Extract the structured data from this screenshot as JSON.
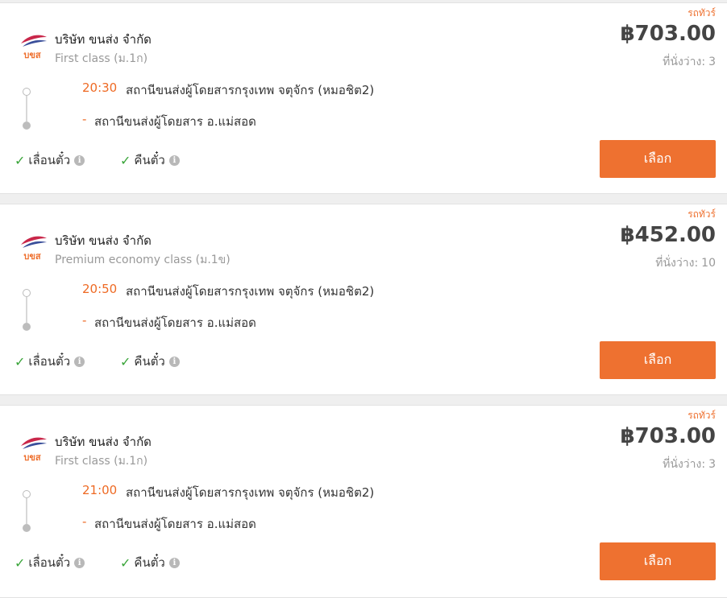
{
  "results": [
    {
      "tag": "รถทัวร์",
      "company": "บริษัท ขนส่ง จำกัด",
      "bus_class": "First class (ม.1ก)",
      "price": "฿703.00",
      "seats_label": "ที่นั่งว่าง:",
      "seats": "3",
      "departure_time": "20:30",
      "departure_station": "สถานีขนส่งผู้โดยสารกรุงเทพ จตุจักร (หมอชิต2)",
      "arrival_dash": "-",
      "arrival_station": "สถานีขนส่งผู้โดยสาร อ.แม่สอด",
      "feature_1": "เลื่อนตั๋ว",
      "feature_2": "คืนตั๋ว",
      "select_label": "เลือก"
    },
    {
      "tag": "รถทัวร์",
      "company": "บริษัท ขนส่ง จำกัด",
      "bus_class": "Premium economy class (ม.1ข)",
      "price": "฿452.00",
      "seats_label": "ที่นั่งว่าง:",
      "seats": "10",
      "departure_time": "20:50",
      "departure_station": "สถานีขนส่งผู้โดยสารกรุงเทพ จตุจักร (หมอชิต2)",
      "arrival_dash": "-",
      "arrival_station": "สถานีขนส่งผู้โดยสาร อ.แม่สอด",
      "feature_1": "เลื่อนตั๋ว",
      "feature_2": "คืนตั๋ว",
      "select_label": "เลือก"
    },
    {
      "tag": "รถทัวร์",
      "company": "บริษัท ขนส่ง จำกัด",
      "bus_class": "First class (ม.1ก)",
      "price": "฿703.00",
      "seats_label": "ที่นั่งว่าง:",
      "seats": "3",
      "departure_time": "21:00",
      "departure_station": "สถานีขนส่งผู้โดยสารกรุงเทพ จตุจักร (หมอชิต2)",
      "arrival_dash": "-",
      "arrival_station": "สถานีขนส่งผู้โดยสาร อ.แม่สอด",
      "feature_1": "เลื่อนตั๋ว",
      "feature_2": "คืนตั๋ว",
      "select_label": "เลือก"
    }
  ],
  "logo_text": "บขส",
  "icons": {
    "check": "check-icon",
    "info": "info-icon",
    "logo": "bus-company-logo"
  },
  "colors": {
    "accent": "#ee7130",
    "check": "#3aa53a",
    "muted": "#999999"
  }
}
